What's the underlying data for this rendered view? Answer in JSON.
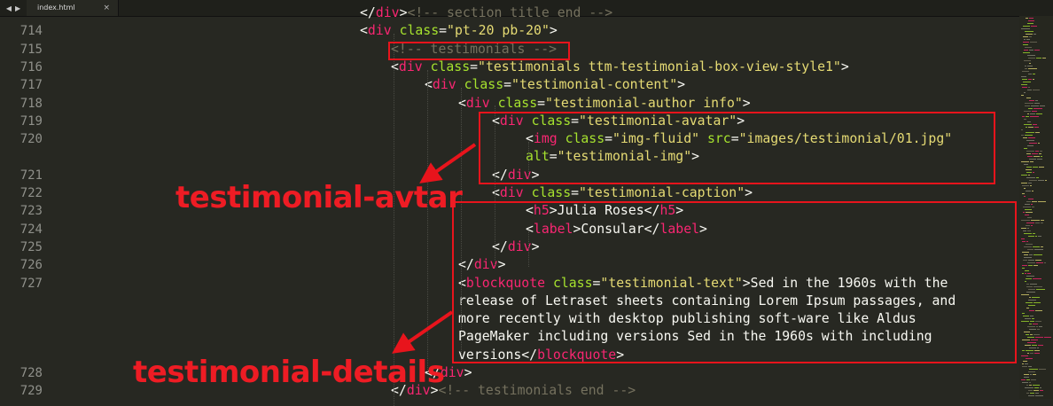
{
  "tab": {
    "title": "index.html",
    "close_glyph": "×"
  },
  "gutter": [
    "714",
    "715",
    "716",
    "717",
    "718",
    "719",
    "720",
    "",
    "721",
    "722",
    "723",
    "724",
    "725",
    "726",
    "727",
    "",
    "",
    "",
    "",
    "728",
    "729"
  ],
  "code": [
    [
      [
        "tx",
        "</"
      ],
      [
        "tg",
        "div"
      ],
      [
        "tx",
        ">"
      ],
      [
        "cm",
        "<!-- section title end -->"
      ]
    ],
    [
      [
        "tx",
        "<"
      ],
      [
        "tg",
        "div"
      ],
      [
        "tx",
        " "
      ],
      [
        "at",
        "class"
      ],
      [
        "tx",
        "="
      ],
      [
        "st",
        "\"pt-20 pb-20\""
      ],
      [
        "tx",
        ">"
      ]
    ],
    [
      [
        "cm",
        "<!-- testimonials -->"
      ]
    ],
    [
      [
        "tx",
        "<"
      ],
      [
        "tg",
        "div"
      ],
      [
        "tx",
        " "
      ],
      [
        "at",
        "class"
      ],
      [
        "tx",
        "="
      ],
      [
        "st",
        "\"testimonials ttm-testimonial-box-view-style1\""
      ],
      [
        "tx",
        ">"
      ]
    ],
    [
      [
        "tx",
        "<"
      ],
      [
        "tg",
        "div"
      ],
      [
        "tx",
        " "
      ],
      [
        "at",
        "class"
      ],
      [
        "tx",
        "="
      ],
      [
        "st",
        "\"testimonial-content\""
      ],
      [
        "tx",
        ">"
      ]
    ],
    [
      [
        "tx",
        "<"
      ],
      [
        "tg",
        "div"
      ],
      [
        "tx",
        " "
      ],
      [
        "at",
        "class"
      ],
      [
        "tx",
        "="
      ],
      [
        "st",
        "\"testimonial-author info\""
      ],
      [
        "tx",
        ">"
      ]
    ],
    [
      [
        "tx",
        "<"
      ],
      [
        "tg",
        "div"
      ],
      [
        "tx",
        " "
      ],
      [
        "at",
        "class"
      ],
      [
        "tx",
        "="
      ],
      [
        "st",
        "\"testimonial-avatar\""
      ],
      [
        "tx",
        ">"
      ]
    ],
    [
      [
        "tx",
        "<"
      ],
      [
        "tg",
        "img"
      ],
      [
        "tx",
        " "
      ],
      [
        "at",
        "class"
      ],
      [
        "tx",
        "="
      ],
      [
        "st",
        "\"img-fluid\""
      ],
      [
        "tx",
        " "
      ],
      [
        "at",
        "src"
      ],
      [
        "tx",
        "="
      ],
      [
        "st",
        "\"images/testimonial/01.jpg\""
      ]
    ],
    [
      [
        "at",
        "alt"
      ],
      [
        "tx",
        "="
      ],
      [
        "st",
        "\"testimonial-img\""
      ],
      [
        "tx",
        ">"
      ]
    ],
    [
      [
        "tx",
        "</"
      ],
      [
        "tg",
        "div"
      ],
      [
        "tx",
        ">"
      ]
    ],
    [
      [
        "tx",
        "<"
      ],
      [
        "tg",
        "div"
      ],
      [
        "tx",
        " "
      ],
      [
        "at",
        "class"
      ],
      [
        "tx",
        "="
      ],
      [
        "st",
        "\"testimonial-caption\""
      ],
      [
        "tx",
        ">"
      ]
    ],
    [
      [
        "tx",
        "<"
      ],
      [
        "tg",
        "h5"
      ],
      [
        "tx",
        ">Julia Roses</"
      ],
      [
        "tg",
        "h5"
      ],
      [
        "tx",
        ">"
      ]
    ],
    [
      [
        "tx",
        "<"
      ],
      [
        "tg",
        "label"
      ],
      [
        "tx",
        ">Consular</"
      ],
      [
        "tg",
        "label"
      ],
      [
        "tx",
        ">"
      ]
    ],
    [
      [
        "tx",
        "</"
      ],
      [
        "tg",
        "div"
      ],
      [
        "tx",
        ">"
      ]
    ],
    [
      [
        "tx",
        "</"
      ],
      [
        "tg",
        "div"
      ],
      [
        "tx",
        ">"
      ]
    ],
    [
      [
        "tx",
        "<"
      ],
      [
        "tg",
        "blockquote"
      ],
      [
        "tx",
        " "
      ],
      [
        "at",
        "class"
      ],
      [
        "tx",
        "="
      ],
      [
        "st",
        "\"testimonial-text\""
      ],
      [
        "tx",
        ">Sed in the 1960s with the"
      ]
    ],
    [
      [
        "tx",
        "release of Letraset sheets containing Lorem Ipsum passages, and"
      ]
    ],
    [
      [
        "tx",
        "more recently with desktop publishing soft-ware like Aldus"
      ]
    ],
    [
      [
        "tx",
        "PageMaker including versions Sed in the 1960s with including"
      ]
    ],
    [
      [
        "tx",
        "versions</"
      ],
      [
        "tg",
        "blockquote"
      ],
      [
        "tx",
        ">"
      ]
    ],
    [
      [
        "tx",
        "</"
      ],
      [
        "tg",
        "div"
      ],
      [
        "tx",
        ">"
      ]
    ],
    [
      [
        "tx",
        "</"
      ],
      [
        "tg",
        "div"
      ],
      [
        "tx",
        ">"
      ],
      [
        "cm",
        "<!-- testimonials end -->"
      ]
    ]
  ],
  "annotations": {
    "avatar_label": "testimonial-avtar",
    "details_label": "testimonial-details"
  },
  "colors": {
    "background": "#272822",
    "tag": "#f92672",
    "attribute": "#a6e22e",
    "string": "#e6db74",
    "comment": "#75715e",
    "annotation": "#ee1c24"
  }
}
